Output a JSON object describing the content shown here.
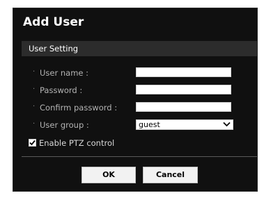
{
  "dialog": {
    "title": "Add User",
    "section_title": "User Setting"
  },
  "form": {
    "bullet": "·",
    "username_label": "User name :",
    "username_value": "",
    "password_label": "Password :",
    "password_value": "",
    "confirm_label": "Confirm password :",
    "confirm_value": "",
    "group_label": "User group :",
    "group_value": "guest",
    "ptz_label": "Enable PTZ control",
    "ptz_checked": true
  },
  "buttons": {
    "ok": "OK",
    "cancel": "Cancel"
  },
  "colors": {
    "dialog_bg": "#101010",
    "section_bg": "#2c2c2c",
    "label_text": "#b4b4b4"
  }
}
